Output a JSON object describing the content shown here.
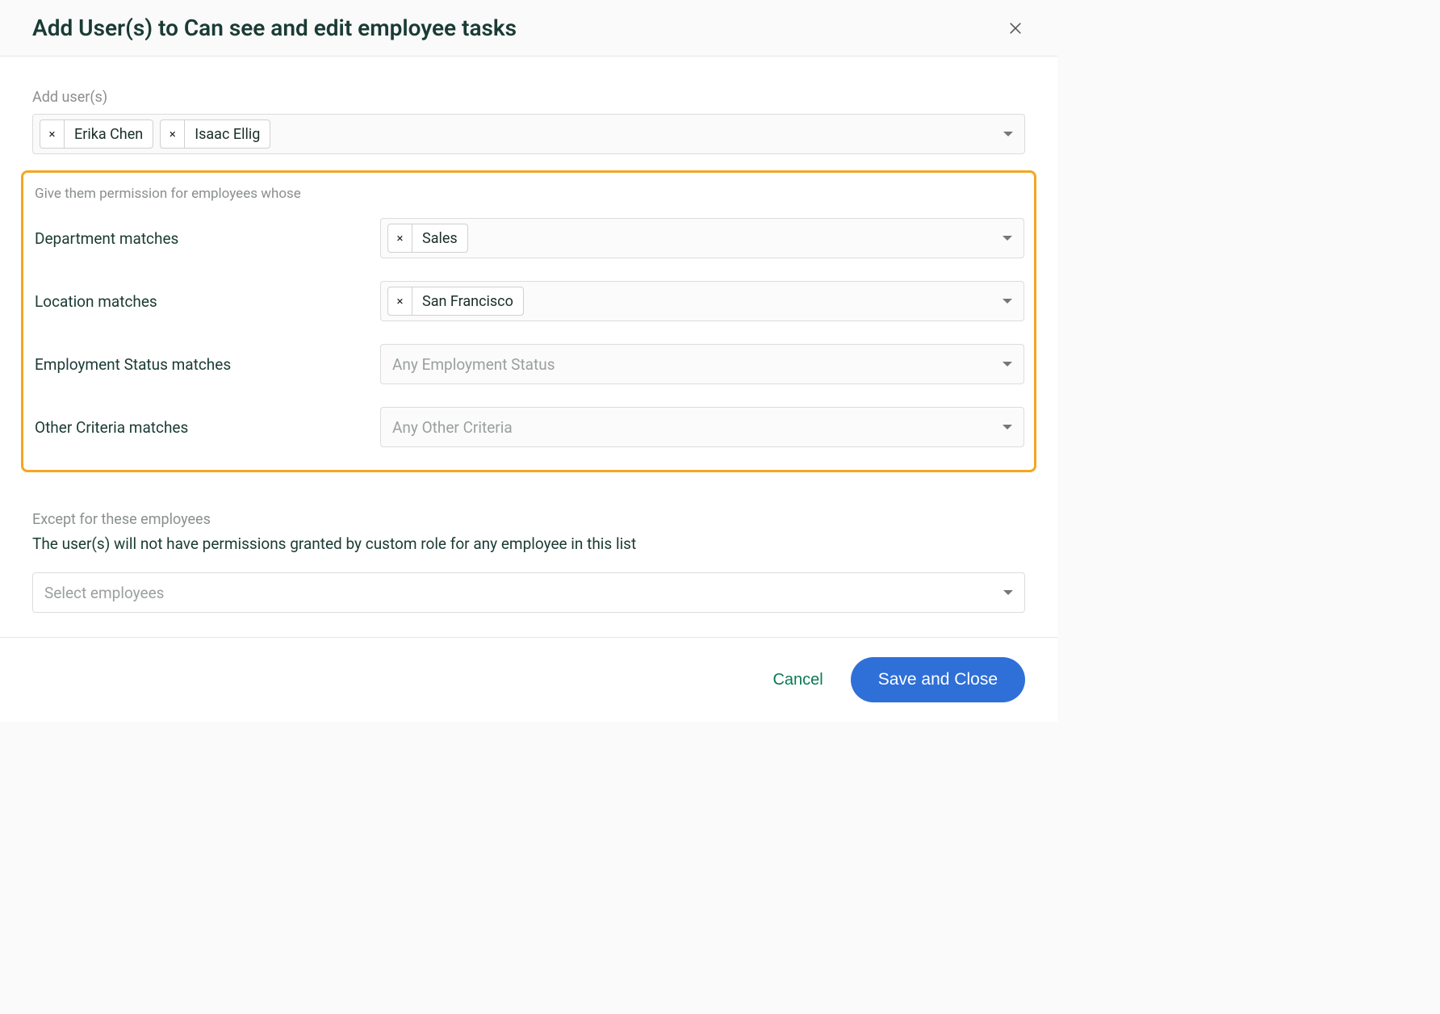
{
  "header": {
    "title": "Add User(s) to Can see and edit employee tasks"
  },
  "add_users": {
    "label": "Add user(s)",
    "chips": [
      "Erika Chen",
      "Isaac Ellig"
    ]
  },
  "permission": {
    "section_label": "Give them permission for employees whose",
    "rows": [
      {
        "label": "Department matches",
        "chips": [
          "Sales"
        ],
        "placeholder": ""
      },
      {
        "label": "Location matches",
        "chips": [
          "San Francisco"
        ],
        "placeholder": ""
      },
      {
        "label": "Employment Status matches",
        "chips": [],
        "placeholder": "Any Employment Status"
      },
      {
        "label": "Other Criteria matches",
        "chips": [],
        "placeholder": "Any Other Criteria"
      }
    ]
  },
  "except": {
    "label": "Except for these employees",
    "description": "The user(s) will not have permissions granted by custom role for any employee in this list",
    "placeholder": "Select employees"
  },
  "footer": {
    "cancel": "Cancel",
    "save": "Save and Close"
  }
}
